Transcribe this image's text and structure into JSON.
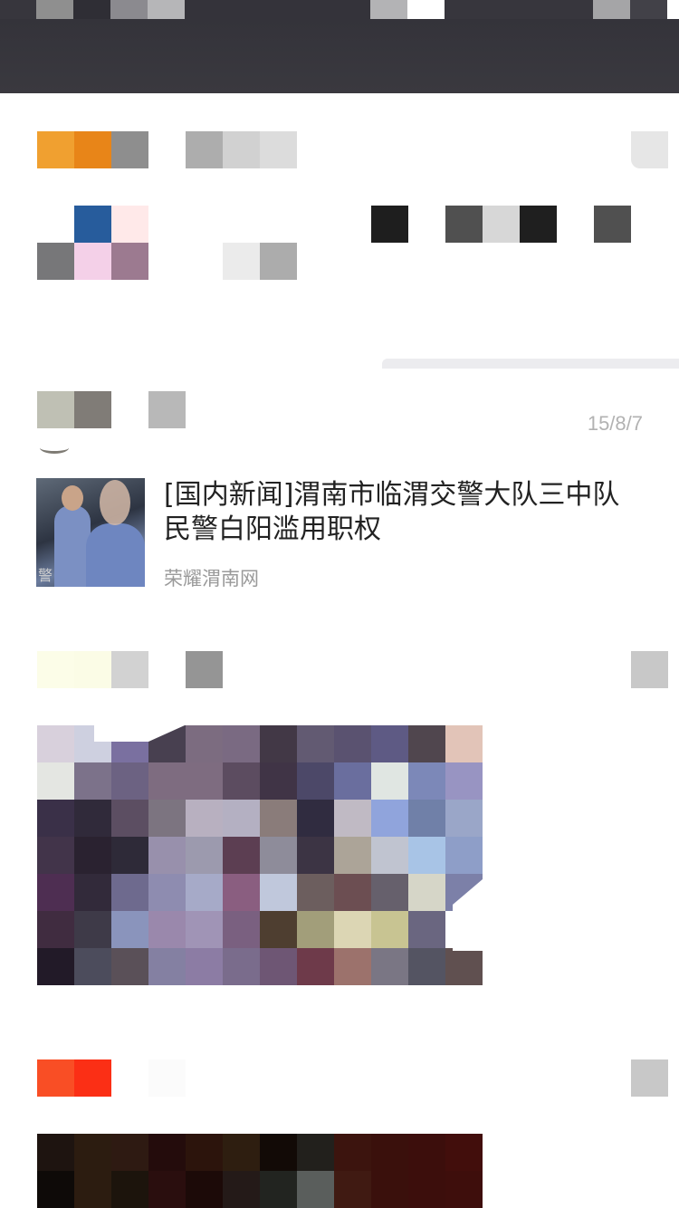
{
  "post": {
    "timestamp": "15/8/7",
    "news": {
      "title": "[国内新闻]渭南市临渭交警大队三中队民警白阳滥用职权",
      "source": "荣耀渭南网",
      "thumb_label": "警"
    }
  },
  "mosaic_colors": {
    "topbar_row": [
      "#8f8f8f",
      "#2f2e35",
      "#8b8a8f",
      "#b6b6b8",
      "#34333a",
      "#34333a",
      "#34333a",
      "#34333a",
      "#34333a",
      "#b3b3b5",
      "#ffffff",
      "#37363d",
      "#37363d",
      "#37363d",
      "#37363d",
      "#a5a5a7",
      "#424148",
      "#ffffff"
    ],
    "profile_row1": [
      "#f0a030",
      "#e88518",
      "#8e8e8e",
      "#ffffff",
      "#adadad",
      "#d1d1d1",
      "#dcdcdc"
    ],
    "profile_row2": [
      "#ffffff",
      "#275c9c",
      "#ffe9e9"
    ],
    "profile_row3": [
      "#777779",
      "#f4d0e8",
      "#9c7a90",
      "#ffffff",
      "#ffffff",
      "#ebebeb",
      "#acacac"
    ],
    "profile_right": [
      "#1e1e1e",
      "#ffffff",
      "#505050",
      "#d7d7d7",
      "#1f1f1f",
      "#ffffff",
      "#505050"
    ],
    "post_name": [
      "#bfc0b4",
      "#807c77",
      "#ffffff",
      "#b8b8b8"
    ],
    "third_name": [
      "#fcfde8",
      "#fbfce6",
      "#d2d2d2",
      "#ffffff",
      "#959595"
    ],
    "fourth_name": [
      "#f94e25",
      "#fb2f15",
      "#ffffff",
      "#fbfbfb"
    ],
    "right_square": "#c8c8c8"
  }
}
